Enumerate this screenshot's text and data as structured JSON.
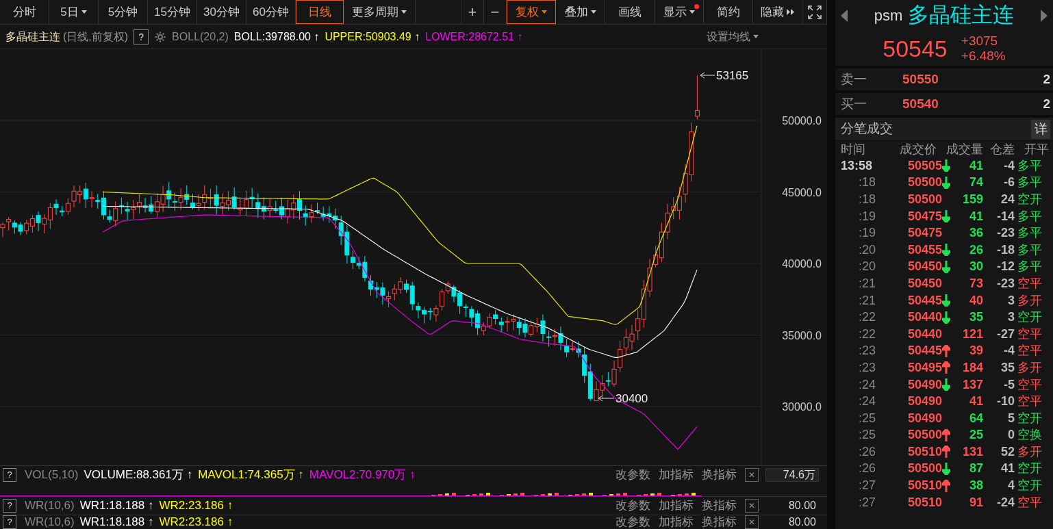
{
  "toolbar": {
    "periods": [
      {
        "label": "分时",
        "dropdown": false,
        "selected": false
      },
      {
        "label": "5日",
        "dropdown": true,
        "selected": false
      },
      {
        "label": "5分钟",
        "dropdown": false,
        "selected": false
      },
      {
        "label": "15分钟",
        "dropdown": false,
        "selected": false
      },
      {
        "label": "30分钟",
        "dropdown": false,
        "selected": false
      },
      {
        "label": "60分钟",
        "dropdown": false,
        "selected": false
      },
      {
        "label": "日线",
        "dropdown": false,
        "selected": true
      },
      {
        "label": "更多周期",
        "dropdown": true,
        "selected": false
      }
    ],
    "tools": [
      {
        "kind": "text",
        "label": "+",
        "dropdown": false,
        "active": false,
        "dot": false
      },
      {
        "kind": "text",
        "label": "−",
        "dropdown": false,
        "active": false,
        "dot": false
      },
      {
        "kind": "text",
        "label": "复权",
        "dropdown": true,
        "active": true,
        "dot": false
      },
      {
        "kind": "text",
        "label": "叠加",
        "dropdown": true,
        "active": false,
        "dot": false
      },
      {
        "kind": "text",
        "label": "画线",
        "dropdown": false,
        "active": false,
        "dot": false
      },
      {
        "kind": "text",
        "label": "显示",
        "dropdown": true,
        "active": false,
        "dot": true
      },
      {
        "kind": "text",
        "label": "简约",
        "dropdown": false,
        "active": false,
        "dot": false
      },
      {
        "kind": "hide",
        "label": "隐藏",
        "dropdown": false,
        "active": false,
        "dot": false
      },
      {
        "kind": "fullscreen",
        "dropdown": false,
        "active": false,
        "dot": false
      }
    ]
  },
  "chart_header": {
    "name": "多晶硅主连",
    "mode": "(日线,前复权)",
    "help": "?",
    "indicator": "BOLL(20,2)",
    "values": [
      {
        "text": "BOLL:39788.00 ↑",
        "color": "#ffffff"
      },
      {
        "text": "UPPER:50903.49 ↑",
        "color": "#ffff00"
      },
      {
        "text": "LOWER:28672.51 ↑",
        "color": "#ff00ff"
      }
    ],
    "settings": "设置均线"
  },
  "price_chart": {
    "axis_labels": [
      "50000.0",
      "45000.0",
      "40000.0",
      "35000.0",
      "30000.0"
    ],
    "high_label": "53165",
    "low_label": "30400"
  },
  "indicator_panels": [
    {
      "help": "?",
      "name": "VOL(5,10)",
      "values": [
        {
          "text": "VOLUME:88.361万 ↑",
          "color": "#ffffff"
        },
        {
          "text": "MAVOL1:74.365万 ↑",
          "color": "#ffff00"
        },
        {
          "text": "MAVOL2:70.970万 ↑",
          "color": "#ff00ff"
        }
      ],
      "actions": [
        "改参数",
        "加指标",
        "换指标"
      ],
      "close": "✕",
      "axis_label": "74.6万"
    },
    {
      "help": "?",
      "name": "WR(10,6)",
      "values": [
        {
          "text": "WR1:18.188 ↑",
          "color": "#ffffff"
        },
        {
          "text": "WR2:23.186 ↑",
          "color": "#ffff00"
        }
      ],
      "actions": [
        "改参数",
        "加指标",
        "换指标"
      ],
      "close": "✕",
      "axis_label": "80.00"
    },
    {
      "help": "?",
      "name": "WR(10,6)",
      "values": [
        {
          "text": "WR1:18.188 ↑",
          "color": "#ffffff"
        },
        {
          "text": "WR2:23.186 ↑",
          "color": "#ffff00"
        }
      ],
      "actions": [
        "改参数",
        "加指标",
        "换指标"
      ],
      "close": "✕",
      "axis_label": "80.00"
    }
  ],
  "quote": {
    "code": "psm",
    "name": "多晶硅主连",
    "price": "50545",
    "change": "+3075",
    "change_pct": "+6.48%"
  },
  "order_book": [
    {
      "label": "卖一",
      "price": "50550",
      "volume": "2"
    },
    {
      "label": "买一",
      "price": "50540",
      "volume": "2"
    }
  ],
  "ticks": {
    "title": "分笔成交",
    "detail_button": "详",
    "columns": [
      "时间",
      "成交价",
      "成交量",
      "仓差",
      "开平"
    ],
    "rows": [
      {
        "time": "13:58",
        "price": "50505",
        "up_arrow": false,
        "down_arrow": true,
        "volume": "41",
        "diff": "-4",
        "type": "多平",
        "color": "#22dd55"
      },
      {
        "time": ":18",
        "price": "50500",
        "up_arrow": false,
        "down_arrow": true,
        "volume": "74",
        "diff": "-6",
        "type": "多平",
        "color": "#22dd55"
      },
      {
        "time": ":18",
        "price": "50500",
        "up_arrow": false,
        "down_arrow": false,
        "volume": "159",
        "diff": "24",
        "type": "空开",
        "color": "#22dd55"
      },
      {
        "time": ":19",
        "price": "50475",
        "up_arrow": false,
        "down_arrow": true,
        "volume": "41",
        "diff": "-14",
        "type": "多平",
        "color": "#22dd55"
      },
      {
        "time": ":19",
        "price": "50475",
        "up_arrow": false,
        "down_arrow": false,
        "volume": "36",
        "diff": "-23",
        "type": "多平",
        "color": "#22dd55"
      },
      {
        "time": ":20",
        "price": "50455",
        "up_arrow": false,
        "down_arrow": true,
        "volume": "26",
        "diff": "-18",
        "type": "多平",
        "color": "#22dd55"
      },
      {
        "time": ":20",
        "price": "50450",
        "up_arrow": false,
        "down_arrow": true,
        "volume": "30",
        "diff": "-12",
        "type": "多平",
        "color": "#22dd55"
      },
      {
        "time": ":21",
        "price": "50450",
        "up_arrow": false,
        "down_arrow": false,
        "volume": "73",
        "diff": "-23",
        "type": "空平",
        "color": "#ff5050"
      },
      {
        "time": ":21",
        "price": "50445",
        "up_arrow": false,
        "down_arrow": true,
        "volume": "40",
        "diff": "3",
        "type": "多开",
        "color": "#ff5050"
      },
      {
        "time": ":22",
        "price": "50440",
        "up_arrow": false,
        "down_arrow": true,
        "volume": "35",
        "diff": "3",
        "type": "空开",
        "color": "#22dd55"
      },
      {
        "time": ":22",
        "price": "50440",
        "up_arrow": false,
        "down_arrow": false,
        "volume": "121",
        "diff": "-27",
        "type": "空平",
        "color": "#ff5050"
      },
      {
        "time": ":23",
        "price": "50445",
        "up_arrow": true,
        "down_arrow": false,
        "volume": "39",
        "diff": "-4",
        "type": "空平",
        "color": "#ff5050"
      },
      {
        "time": ":23",
        "price": "50495",
        "up_arrow": true,
        "down_arrow": false,
        "volume": "184",
        "diff": "35",
        "type": "多开",
        "color": "#ff5050"
      },
      {
        "time": ":24",
        "price": "50490",
        "up_arrow": false,
        "down_arrow": true,
        "volume": "137",
        "diff": "-5",
        "type": "空平",
        "color": "#ff5050"
      },
      {
        "time": ":24",
        "price": "50490",
        "up_arrow": false,
        "down_arrow": false,
        "volume": "41",
        "diff": "-10",
        "type": "空平",
        "color": "#ff5050"
      },
      {
        "time": ":25",
        "price": "50490",
        "up_arrow": false,
        "down_arrow": false,
        "volume": "64",
        "diff": "5",
        "type": "空开",
        "color": "#22dd55"
      },
      {
        "time": ":25",
        "price": "50500",
        "up_arrow": true,
        "down_arrow": false,
        "volume": "25",
        "diff": "0",
        "type": "空换",
        "color": "#22dd55"
      },
      {
        "time": ":26",
        "price": "50510",
        "up_arrow": true,
        "down_arrow": false,
        "volume": "131",
        "diff": "52",
        "type": "多开",
        "color": "#ff5050"
      },
      {
        "time": ":26",
        "price": "50500",
        "up_arrow": false,
        "down_arrow": true,
        "volume": "87",
        "diff": "41",
        "type": "空开",
        "color": "#22dd55"
      },
      {
        "time": ":27",
        "price": "50510",
        "up_arrow": true,
        "down_arrow": false,
        "volume": "38",
        "diff": "4",
        "type": "空开",
        "color": "#22dd55"
      },
      {
        "time": ":27",
        "price": "50510",
        "up_arrow": false,
        "down_arrow": false,
        "volume": "91",
        "diff": "-24",
        "type": "空平",
        "color": "#ff5050"
      }
    ]
  }
}
